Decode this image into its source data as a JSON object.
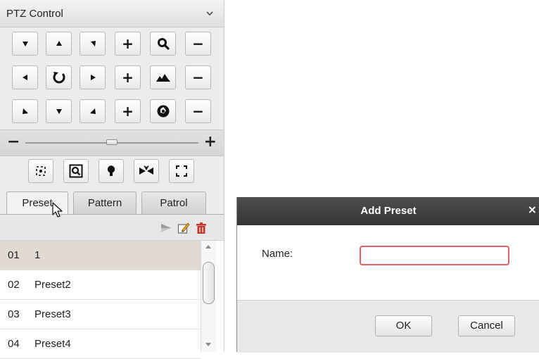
{
  "ptz_panel": {
    "title": "PTZ Control",
    "direction_grid": [
      [
        "arrow-down-right-icon",
        "arrow-up-icon",
        "arrow-down-left-icon",
        "+",
        "zoom-icon",
        "−"
      ],
      [
        "arrow-left-icon",
        "auto-rotate-icon",
        "arrow-right-icon",
        "+",
        "focus-icon",
        "−"
      ],
      [
        "arrow-up-right-icon",
        "arrow-down-icon",
        "arrow-up-left-icon",
        "+",
        "iris-icon",
        "−"
      ]
    ],
    "speed": {
      "minus": "−",
      "plus": "+",
      "level": 0.5
    },
    "functions": [
      "light-icon",
      "wiper-icon",
      "manual-focus-icon",
      "lens-init-icon",
      "menu-icon"
    ],
    "tabs": [
      "Preset",
      "Pattern",
      "Patrol"
    ],
    "active_tab": "Preset",
    "toolbar": [
      "call-preset-icon",
      "edit-preset-icon",
      "delete-preset-icon"
    ],
    "presets": [
      {
        "num": "01",
        "name": "1",
        "selected": true
      },
      {
        "num": "02",
        "name": "Preset2",
        "selected": false
      },
      {
        "num": "03",
        "name": "Preset3",
        "selected": false
      },
      {
        "num": "04",
        "name": "Preset4",
        "selected": false
      }
    ]
  },
  "dialog": {
    "title": "Add Preset",
    "close": "×",
    "name_label": "Name:",
    "name_value": "",
    "ok": "OK",
    "cancel": "Cancel"
  },
  "colors": {
    "dialog_titlebar": "#3f3f3f",
    "input_focus_border": "#e0606a",
    "selected_row": "#e0dad2",
    "delete_icon": "#c0392b"
  }
}
